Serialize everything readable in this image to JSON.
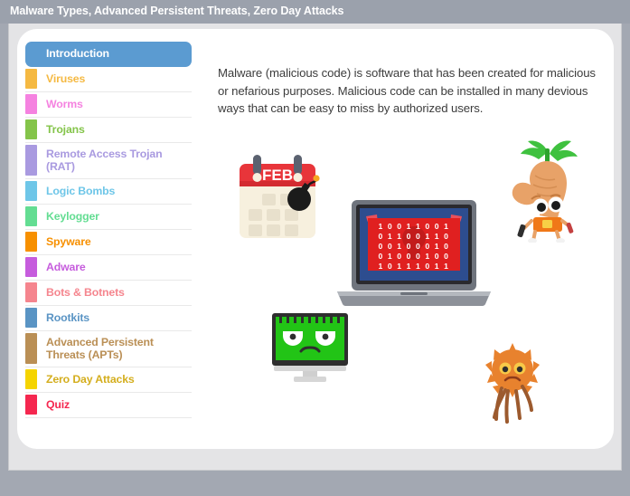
{
  "window": {
    "title": "Malware Types, Advanced Persistent Threats, Zero Day Attacks"
  },
  "sidebar": {
    "items": [
      {
        "label": "Introduction",
        "color": "#5b9bd1",
        "text_color": "#ffffff",
        "active": true
      },
      {
        "label": "Viruses",
        "color": "#f5b942",
        "text_color": "#f5b942",
        "active": false
      },
      {
        "label": "Worms",
        "color": "#f582e0",
        "text_color": "#f582e0",
        "active": false
      },
      {
        "label": "Trojans",
        "color": "#84c44a",
        "text_color": "#84c44a",
        "active": false
      },
      {
        "label": "Remote Access Trojan (RAT)",
        "color": "#a99ae0",
        "text_color": "#a99ae0",
        "active": false
      },
      {
        "label": "Logic Bombs",
        "color": "#6ec6e8",
        "text_color": "#6ec6e8",
        "active": false
      },
      {
        "label": "Keylogger",
        "color": "#63dd92",
        "text_color": "#63dd92",
        "active": false
      },
      {
        "label": "Spyware",
        "color": "#f79000",
        "text_color": "#f79000",
        "active": false
      },
      {
        "label": "Adware",
        "color": "#c65cdd",
        "text_color": "#c65cdd",
        "active": false
      },
      {
        "label": "Bots & Botnets",
        "color": "#f5858e",
        "text_color": "#f5858e",
        "active": false
      },
      {
        "label": "Rootkits",
        "color": "#5a94c4",
        "text_color": "#5a94c4",
        "active": false
      },
      {
        "label": "Advanced Persistent Threats (APTs)",
        "color": "#ba8f55",
        "text_color": "#ba8f55",
        "active": false
      },
      {
        "label": "Zero Day Attacks",
        "color": "#f5d400",
        "text_color": "#d4ae1e",
        "active": false
      },
      {
        "label": "Quiz",
        "color": "#f5274f",
        "text_color": "#f5274f",
        "active": false
      }
    ]
  },
  "main": {
    "paragraph": "Malware (malicious code) is software that has been created for malicious or nefarious purposes. Malicious code can be installed in many devious ways that can be easy to miss by authorized users."
  },
  "illustrations": {
    "calendar": {
      "name": "calendar-bomb-illustration",
      "month_label": "FEB",
      "header_color": "#e8353a",
      "body_color": "#f7f0de",
      "cell_color": "#e8e0cc",
      "bomb_color": "#1b1b1b",
      "fuse_color": "#f5a623"
    },
    "laptop": {
      "name": "laptop-binary-illustration",
      "screen_color": "#2d4d8f",
      "panel_color": "#e02020",
      "horn_color": "#e8505b",
      "body_color": "#8d9199",
      "binary_rows": [
        "1 0 0 1 1 0 0 1",
        "0 1 1 0 0 1 1 0",
        "0 0 1 0 0 0 1 0",
        "0 1 0 0 0 1 0 0",
        "1 0 1 1 1 0 1 1"
      ]
    },
    "carrot": {
      "name": "carrot-character-illustration",
      "body_color": "#e8a268",
      "leaf_color": "#3fc13f",
      "belt_color": "#f07818"
    },
    "monitor": {
      "name": "monster-monitor-illustration",
      "screen_color": "#22c416",
      "bezel_color": "#2e2e2e",
      "stand_color": "#cfcfcf"
    },
    "germ": {
      "name": "germ-character-illustration",
      "body_color": "#e8822e",
      "leg_color": "#9c5a2e",
      "eye_color": "#f7c948"
    }
  }
}
